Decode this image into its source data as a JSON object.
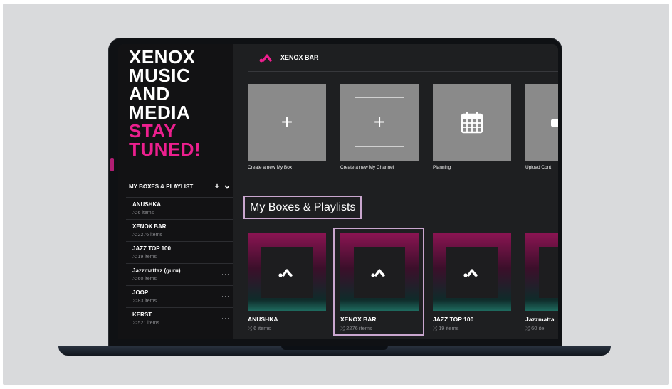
{
  "hero": {
    "lines_white": [
      "XENOX",
      "MUSIC",
      "AND",
      "MEDIA"
    ],
    "lines_pink": [
      "STAY",
      "TUNED!"
    ],
    "accent_color": "#ec1f8e"
  },
  "sidebar": {
    "header": "MY BOXES & PLAYLIST",
    "add_icon": "plus-icon",
    "collapse_icon": "chevron-down-icon",
    "items": [
      {
        "name": "ANUSHKA",
        "count": "6 items"
      },
      {
        "name": "XENOX BAR",
        "count": "2276 items"
      },
      {
        "name": "JAZZ TOP 100",
        "count": "19 items"
      },
      {
        "name": "Jazzmattaz (guru)",
        "count": "60 items"
      },
      {
        "name": "JOOP",
        "count": "83 items"
      },
      {
        "name": "KERST",
        "count": "521 items"
      }
    ],
    "more_label": "···"
  },
  "topbar": {
    "title": "XENOX BAR"
  },
  "quick_actions": [
    {
      "label": "Create a new My Box",
      "icon": "plus-icon"
    },
    {
      "label": "Create a new My Channel",
      "icon": "plus-icon"
    },
    {
      "label": "Planning",
      "icon": "calendar-icon"
    },
    {
      "label": "Upload Cont",
      "icon": "upload-icon"
    }
  ],
  "section": {
    "title": "My Boxes & Playlists"
  },
  "cards": [
    {
      "name": "ANUSHKA",
      "count": "6 items"
    },
    {
      "name": "XENOX BAR",
      "count": "2276 items"
    },
    {
      "name": "JAZZ TOP 100",
      "count": "19 items"
    },
    {
      "name": "Jazzmatta",
      "count": "60 ite"
    }
  ]
}
